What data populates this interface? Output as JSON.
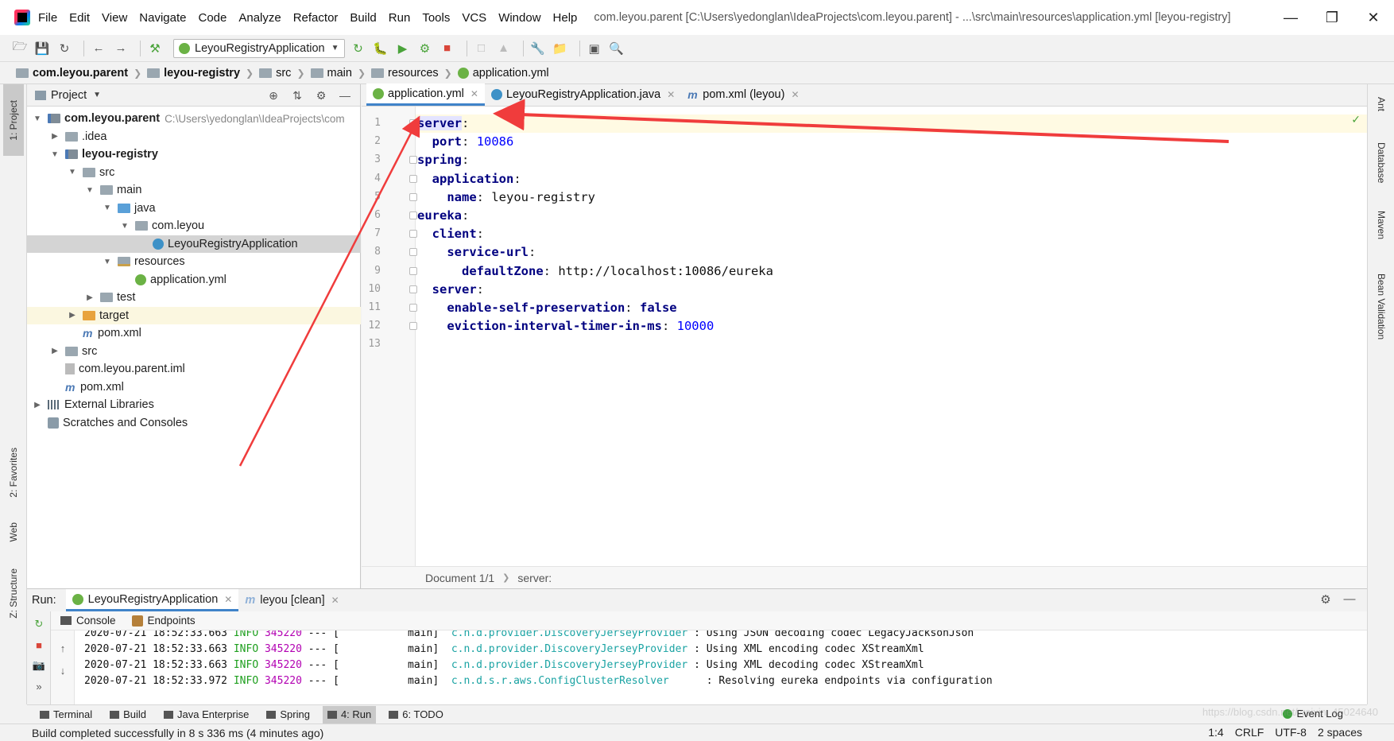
{
  "menubar": {
    "items": [
      "File",
      "Edit",
      "View",
      "Navigate",
      "Code",
      "Analyze",
      "Refactor",
      "Build",
      "Run",
      "Tools",
      "VCS",
      "Window",
      "Help"
    ],
    "title": "com.leyou.parent [C:\\Users\\yedonglan\\IdeaProjects\\com.leyou.parent] - ...\\src\\main\\resources\\application.yml [leyou-registry]"
  },
  "toolbar": {
    "run_config": "LeyouRegistryApplication"
  },
  "breadcrumb": [
    "com.leyou.parent",
    "leyou-registry",
    "src",
    "main",
    "resources",
    "application.yml"
  ],
  "left_strip": {
    "project": "1: Project",
    "favorites": "2: Favorites",
    "web": "Web",
    "structure": "Z: Structure"
  },
  "right_strip": [
    "Ant",
    "Database",
    "Maven",
    "Bean Validation"
  ],
  "project_panel": {
    "title": "Project",
    "tree": [
      {
        "label": "com.leyou.parent",
        "hint": "C:\\Users\\yedonglan\\IdeaProjects\\com",
        "depth": 0,
        "arrow": "down",
        "icon": "module",
        "bold": true
      },
      {
        "label": ".idea",
        "depth": 1,
        "arrow": "right",
        "icon": "folder"
      },
      {
        "label": "leyou-registry",
        "depth": 1,
        "arrow": "down",
        "icon": "module",
        "bold": true
      },
      {
        "label": "src",
        "depth": 2,
        "arrow": "down",
        "icon": "folder"
      },
      {
        "label": "main",
        "depth": 3,
        "arrow": "down",
        "icon": "folder"
      },
      {
        "label": "java",
        "depth": 4,
        "arrow": "down",
        "icon": "folder-blue"
      },
      {
        "label": "com.leyou",
        "depth": 5,
        "arrow": "down",
        "icon": "folder"
      },
      {
        "label": "LeyouRegistryApplication",
        "depth": 6,
        "arrow": "",
        "icon": "class",
        "selected": true
      },
      {
        "label": "resources",
        "depth": 4,
        "arrow": "down",
        "icon": "folder-res"
      },
      {
        "label": "application.yml",
        "depth": 5,
        "arrow": "",
        "icon": "yml"
      },
      {
        "label": "test",
        "depth": 3,
        "arrow": "right",
        "icon": "folder"
      },
      {
        "label": "target",
        "depth": 2,
        "arrow": "right",
        "icon": "folder-orange",
        "excluded": true
      },
      {
        "label": "pom.xml",
        "depth": 2,
        "arrow": "",
        "icon": "maven"
      },
      {
        "label": "src",
        "depth": 1,
        "arrow": "right",
        "icon": "folder"
      },
      {
        "label": "com.leyou.parent.iml",
        "depth": 1,
        "arrow": "",
        "icon": "iml"
      },
      {
        "label": "pom.xml",
        "depth": 1,
        "arrow": "",
        "icon": "maven"
      },
      {
        "label": "External Libraries",
        "depth": 0,
        "arrow": "right",
        "icon": "lib"
      },
      {
        "label": "Scratches and Consoles",
        "depth": 0,
        "arrow": "",
        "icon": "scratch"
      }
    ]
  },
  "editor": {
    "tabs": [
      {
        "label": "application.yml",
        "active": true
      },
      {
        "label": "LeyouRegistryApplication.java",
        "active": false
      },
      {
        "label": "pom.xml (leyou)",
        "active": false
      }
    ],
    "lines": [
      {
        "n": "1",
        "indent": 0,
        "key": "server",
        "val": ""
      },
      {
        "n": "2",
        "indent": 1,
        "key": "port",
        "val": "10086",
        "num": true
      },
      {
        "n": "3",
        "indent": 0,
        "key": "spring",
        "val": ""
      },
      {
        "n": "4",
        "indent": 1,
        "key": "application",
        "val": ""
      },
      {
        "n": "5",
        "indent": 2,
        "key": "name",
        "val": "leyou-registry",
        "plain": true
      },
      {
        "n": "6",
        "indent": 0,
        "key": "eureka",
        "val": ""
      },
      {
        "n": "7",
        "indent": 1,
        "key": "client",
        "val": ""
      },
      {
        "n": "8",
        "indent": 2,
        "key": "service-url",
        "val": ""
      },
      {
        "n": "9",
        "indent": 3,
        "key": "defaultZone",
        "val": "http://localhost:10086/eureka",
        "plain": true
      },
      {
        "n": "10",
        "indent": 1,
        "key": "server",
        "val": ""
      },
      {
        "n": "11",
        "indent": 2,
        "key": "enable-self-preservation",
        "val": "false",
        "kw": true
      },
      {
        "n": "12",
        "indent": 2,
        "key": "eviction-interval-timer-in-ms",
        "val": "10000",
        "num": true
      },
      {
        "n": "13",
        "indent": 0,
        "key": "",
        "val": ""
      }
    ],
    "status_doc": "Document 1/1",
    "status_path": "server:"
  },
  "run_panel": {
    "label": "Run:",
    "tabs": [
      {
        "label": "LeyouRegistryApplication",
        "active": true
      },
      {
        "label": "leyou [clean]",
        "active": false
      }
    ],
    "subtabs": [
      "Console",
      "Endpoints"
    ],
    "log": [
      {
        "ts": "2020-07-21 18:52:33.663",
        "level": "INFO",
        "pid": "345220",
        "sep": "---",
        "thread": "[           main]",
        "cls": "c.n.d.provider.DiscoveryJerseyProvider",
        "msg": ": Using JSON decoding codec LegacyJacksonJson"
      },
      {
        "ts": "2020-07-21 18:52:33.663",
        "level": "INFO",
        "pid": "345220",
        "sep": "---",
        "thread": "[           main]",
        "cls": "c.n.d.provider.DiscoveryJerseyProvider",
        "msg": ": Using XML encoding codec XStreamXml"
      },
      {
        "ts": "2020-07-21 18:52:33.663",
        "level": "INFO",
        "pid": "345220",
        "sep": "---",
        "thread": "[           main]",
        "cls": "c.n.d.provider.DiscoveryJerseyProvider",
        "msg": ": Using XML decoding codec XStreamXml"
      },
      {
        "ts": "2020-07-21 18:52:33.972",
        "level": "INFO",
        "pid": "345220",
        "sep": "---",
        "thread": "[           main]",
        "cls": "c.n.d.s.r.aws.ConfigClusterResolver     ",
        "msg": ": Resolving eureka endpoints via configuration"
      }
    ]
  },
  "bottom_tabs": [
    {
      "label": "Terminal",
      "active": false
    },
    {
      "label": "Build",
      "active": false
    },
    {
      "label": "Java Enterprise",
      "active": false
    },
    {
      "label": "Spring",
      "active": false
    },
    {
      "label": "4: Run",
      "active": true
    },
    {
      "label": "6: TODO",
      "active": false
    }
  ],
  "event_log": "Event Log",
  "statusbar": {
    "message": "Build completed successfully in 8 s 336 ms (4 minutes ago)",
    "position": "1:4",
    "line_sep": "CRLF",
    "encoding": "UTF-8",
    "indent": "2 spaces"
  },
  "watermark": "https://blog.csdn.net/weixin_45024640",
  "colors": {
    "accent": "#4083c9",
    "annotation": "#f03c3c"
  }
}
